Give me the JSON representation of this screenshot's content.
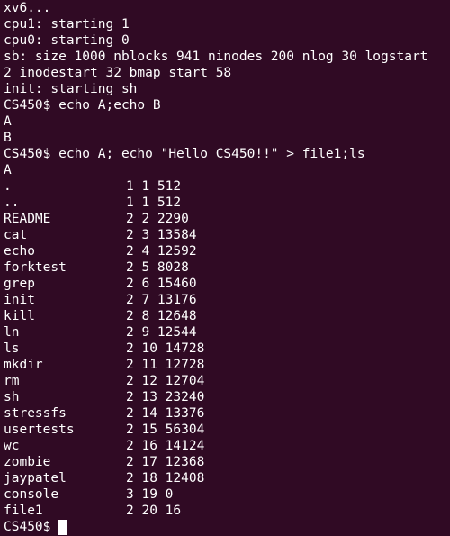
{
  "terminal": {
    "boot_lines": [
      "xv6...",
      "cpu1: starting 1",
      "cpu0: starting 0",
      "sb: size 1000 nblocks 941 ninodes 200 nlog 30 logstart",
      "2 inodestart 32 bmap start 58",
      "init: starting sh"
    ],
    "session1": {
      "command": "CS450$ echo A;echo B",
      "output": [
        "A",
        "B"
      ]
    },
    "session2": {
      "command": "CS450$ echo A; echo \"Hello CS450!!\" > file1;ls",
      "output_first": "A"
    },
    "ls_listing": [
      {
        "name": ".",
        "meta": "1 1 512"
      },
      {
        "name": "..",
        "meta": "1 1 512"
      },
      {
        "name": "README",
        "meta": "2 2 2290"
      },
      {
        "name": "cat",
        "meta": "2 3 13584"
      },
      {
        "name": "echo",
        "meta": "2 4 12592"
      },
      {
        "name": "forktest",
        "meta": "2 5 8028"
      },
      {
        "name": "grep",
        "meta": "2 6 15460"
      },
      {
        "name": "init",
        "meta": "2 7 13176"
      },
      {
        "name": "kill",
        "meta": "2 8 12648"
      },
      {
        "name": "ln",
        "meta": "2 9 12544"
      },
      {
        "name": "ls",
        "meta": "2 10 14728"
      },
      {
        "name": "mkdir",
        "meta": "2 11 12728"
      },
      {
        "name": "rm",
        "meta": "2 12 12704"
      },
      {
        "name": "sh",
        "meta": "2 13 23240"
      },
      {
        "name": "stressfs",
        "meta": "2 14 13376"
      },
      {
        "name": "usertests",
        "meta": "2 15 56304"
      },
      {
        "name": "wc",
        "meta": "2 16 14124"
      },
      {
        "name": "zombie",
        "meta": "2 17 12368"
      },
      {
        "name": "jaypatel",
        "meta": "2 18 12408"
      },
      {
        "name": "console",
        "meta": "3 19 0"
      },
      {
        "name": "file1",
        "meta": "2 20 16"
      }
    ],
    "final_prompt": "CS450$",
    "colors": {
      "background": "#300a24",
      "foreground": "#ffffff"
    }
  }
}
